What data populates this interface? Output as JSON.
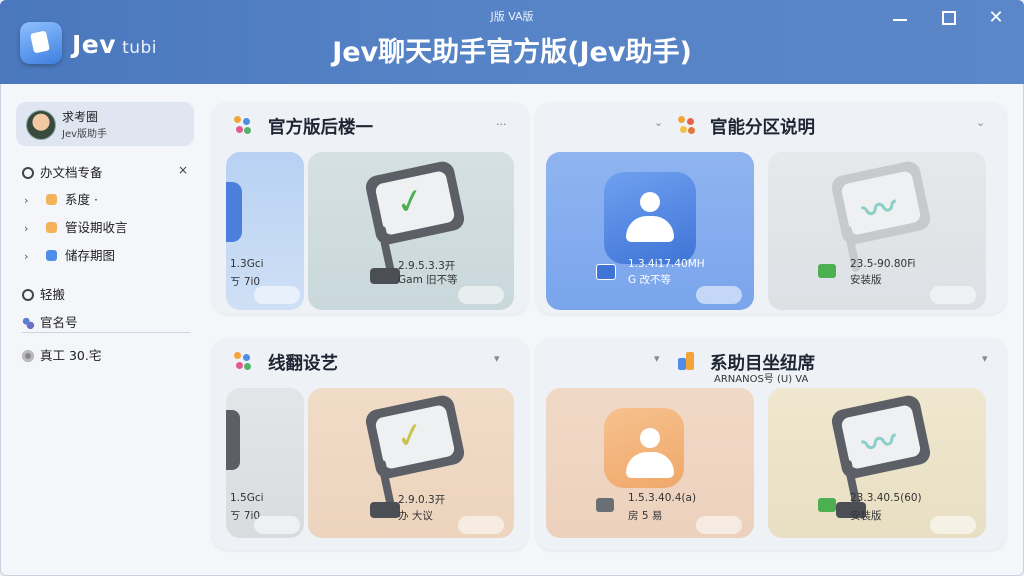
{
  "window": {
    "caption": "J版 VA版",
    "title": "Jev聊天助手官方版(Jev助手)",
    "app_name": "Jev",
    "app_name_suffix": "tubi",
    "controls": [
      "minimize",
      "maximize",
      "close"
    ]
  },
  "colors": {
    "header": "#4f7ec3",
    "panel_bg": "#eef1f5",
    "accent_blue": "#5b8fe6",
    "accent_orange": "#f0b47a",
    "check_green": "#4caf50"
  },
  "sidebar": {
    "user": {
      "name": "求考圈",
      "subtitle": "Jev版助手"
    },
    "section1": {
      "title": "办文档专备",
      "close": "×"
    },
    "items": [
      {
        "label": "系度 ·",
        "color": "#f2b35b"
      },
      {
        "label": "管设期收言",
        "color": "#f2b35b"
      },
      {
        "label": "储存期图",
        "color": "#4f8de6"
      }
    ],
    "links": [
      {
        "label": "轻搬",
        "icon": "refresh-icon"
      },
      {
        "label": "官名号",
        "icon": "people-icon"
      }
    ],
    "footer": {
      "label": "真工 30.宅",
      "icon": "disc-icon"
    }
  },
  "panels": [
    {
      "title": "官方版后楼一",
      "dots": "···",
      "cards": [
        {
          "line1": "1.3Gci",
          "line2": "ㄎ 7i0"
        },
        {
          "line1": "2.9.5.3.3开",
          "line2": "Gam 旧不等"
        }
      ]
    },
    {
      "title": "官能分区说明",
      "caret": "⌄",
      "cards": [
        {
          "line1": "1.3.4i17.40MH",
          "line2": "G 改不等"
        },
        {
          "line1": "23.5-90.80Fi",
          "line2": "安装版"
        }
      ]
    },
    {
      "title": "线翻设艺",
      "caret": "▾",
      "cards": [
        {
          "line1": "1.5Gci",
          "line2": "ㄎ 7i0"
        },
        {
          "line1": "2.9.0.3开",
          "line2": "办 大议"
        }
      ]
    },
    {
      "title": "系助目坐纽席",
      "subtitle": "ARNANOS号 (U) VA",
      "caret": "▾",
      "cards": [
        {
          "line1": "1.5.3.40.4(a)",
          "line2": "房 5 易"
        },
        {
          "line1": "23.3.40.5(60)",
          "line2": "安装版"
        }
      ]
    }
  ]
}
